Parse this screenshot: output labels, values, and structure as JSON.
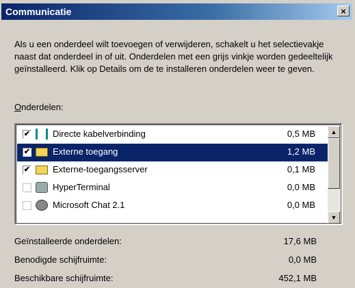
{
  "window": {
    "title": "Communicatie",
    "close_glyph": "×"
  },
  "description": "Als u een onderdeel wilt toevoegen of verwijderen, schakelt u het selectievakje naast dat onderdeel in of uit. Onderdelen met een grijs vinkje worden gedeeltelijk geïnstalleerd. Klik op Details om de te installeren onderdelen weer te geven.",
  "components_label": {
    "accel": "O",
    "rest": "nderdelen:"
  },
  "components": [
    {
      "name": "Directe kabelverbinding",
      "size": "0,5 MB",
      "checked": true,
      "icon": "cable-connection-icon"
    },
    {
      "name": "Externe toegang",
      "size": "1,2 MB",
      "checked": true,
      "selected": true,
      "icon": "folder-icon"
    },
    {
      "name": "Externe-toegangsserver",
      "size": "0,1 MB",
      "checked": true,
      "icon": "folder-icon"
    },
    {
      "name": "HyperTerminal",
      "size": "0,0 MB",
      "checked": false,
      "icon": "phone-icon"
    },
    {
      "name": "Microsoft Chat 2.1",
      "size": "0,0 MB",
      "checked": false,
      "icon": "chat-icon"
    }
  ],
  "stats": [
    {
      "label": "Geïnstalleerde onderdelen:",
      "value": "17,6 MB"
    },
    {
      "label": "Benodigde schijfruimte:",
      "value": "0,0 MB"
    },
    {
      "label": "Beschikbare schijfruimte:",
      "value": "452,1 MB"
    }
  ],
  "colors": {
    "selection": "#0a246a",
    "face": "#d4d0c8",
    "title_start": "#0a246a"
  }
}
